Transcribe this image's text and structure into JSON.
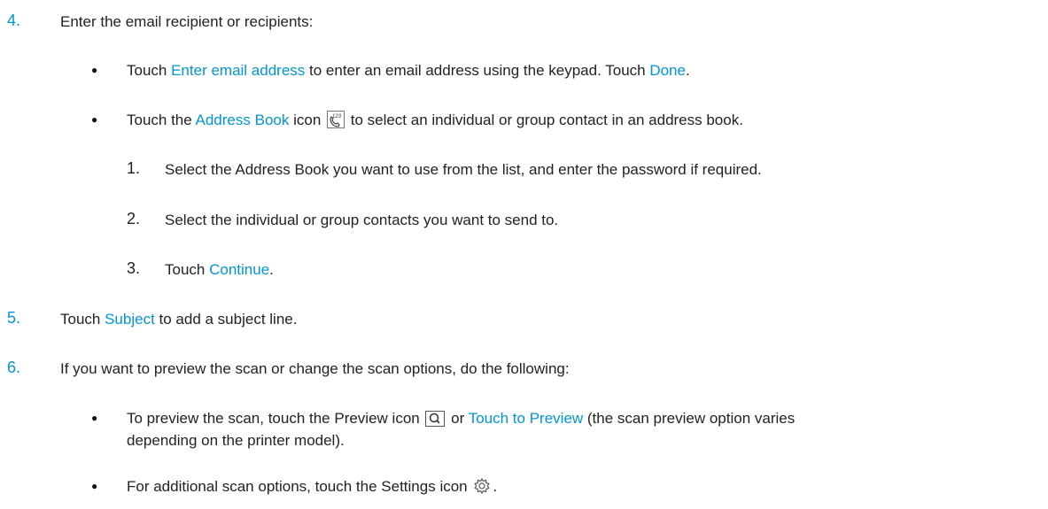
{
  "step4": {
    "number": "4.",
    "text": "Enter the email recipient or recipients:",
    "bullet1": {
      "prefix": "Touch ",
      "link1": "Enter email address",
      "middle": " to enter an email address using the keypad. Touch ",
      "link2": "Done",
      "suffix": "."
    },
    "bullet2": {
      "prefix": "Touch the ",
      "link": "Address Book",
      "middle": " icon ",
      "icon": "address-book-icon",
      "suffix": " to select an individual or group contact in an address book."
    },
    "substeps": [
      {
        "number": "1.",
        "text": "Select the Address Book you want to use from the list, and enter the password if required."
      },
      {
        "number": "2.",
        "text": "Select the individual or group contacts you want to send to."
      },
      {
        "number": "3.",
        "prefix": "Touch ",
        "link": "Continue",
        "suffix": "."
      }
    ]
  },
  "step5": {
    "number": "5.",
    "prefix": "Touch ",
    "link": "Subject",
    "suffix": " to add a subject line."
  },
  "step6": {
    "number": "6.",
    "text": "If you want to preview the scan or change the scan options, do the following:",
    "bullet1": {
      "prefix": "To preview the scan, touch the Preview icon ",
      "icon": "preview-icon",
      "middle": " or ",
      "link": "Touch to Preview",
      "suffix": " (the scan preview option varies",
      "continuation": "depending on the printer model)."
    },
    "bullet2": {
      "prefix": "For additional scan options, touch the Settings icon ",
      "icon": "settings-icon",
      "suffix": "."
    }
  },
  "colors": {
    "link": "#0096d6",
    "text": "#222222"
  }
}
